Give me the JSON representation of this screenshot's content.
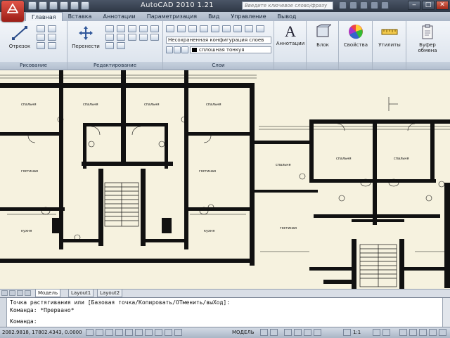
{
  "title_bar": {
    "app_title": "AutoCAD 2010     1.21",
    "search_placeholder": "Введите ключевое слово/фразу"
  },
  "ribbon_tabs": [
    "Главная",
    "Вставка",
    "Аннотации",
    "Параметризация",
    "Вид",
    "Управление",
    "Вывод"
  ],
  "ribbon": {
    "draw": {
      "label": "Рисование",
      "line_label": "Отрезок"
    },
    "modify": {
      "label": "Редактирование",
      "move_label": "Перенести"
    },
    "layers": {
      "label": "Слои",
      "state_combo": "Несохраненная конфигурация слоев",
      "layer_combo": "сплошная тонкуя"
    },
    "annotation": {
      "label": "Аннотации"
    },
    "block": {
      "label": "Блок"
    },
    "properties": {
      "label": "Свойства"
    },
    "utilities": {
      "label": "Утилиты"
    },
    "clipboard": {
      "label": "Буфер обмена"
    }
  },
  "drawing_labels": {
    "bedroom": "спальня",
    "living": "гостиная",
    "kitchen": "кухня"
  },
  "layout_tabs": [
    "Модель",
    "Layout1",
    "Layout2"
  ],
  "command_lines": [
    "Точка растягивания или [Базовая точка/Копировать/ОТменить/выХод]:",
    "Команда: *Прервано*",
    "Команда:"
  ],
  "status_bar": {
    "coordinates": "2082.9818, 17802.4343, 0.0000",
    "model_label": "МОДЕЛЬ",
    "scale": "1:1"
  },
  "colors": {
    "title_bg": "#2f3846",
    "app_button": "#c8352b",
    "drawing_bg": "#f6f2df",
    "ribbon_bg": "#e4eaf2"
  }
}
